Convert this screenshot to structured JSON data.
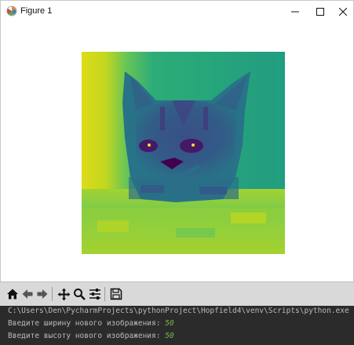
{
  "window": {
    "title": "Figure 1",
    "icon": "matplotlib-logo-icon",
    "controls": [
      "minimize-icon",
      "maximize-icon",
      "close-icon"
    ]
  },
  "figure": {
    "image_description_colormap": "viridis",
    "subject": "cat photo rendered as pixelated grayscale-to-viridis image"
  },
  "toolbar": {
    "tools": [
      "home-icon",
      "back-icon",
      "forward-icon",
      "pan-icon",
      "zoom-icon",
      "configure-subplots-icon",
      "save-icon"
    ]
  },
  "console": {
    "command": "C:\\Users\\Den\\PycharmProjects\\pythonProject\\Hopfield4\\venv\\Scripts\\python.exe C",
    "prompt_width": "Введите ширину нового изображения: ",
    "width_value": "50",
    "prompt_height": "Введите высоту нового изображения: ",
    "height_value": "50"
  },
  "colors": {
    "viridis_yellow": "#e2e418",
    "viridis_green": "#5ec962",
    "viridis_teal": "#21918c",
    "viridis_blue": "#3b528b",
    "viridis_purple": "#440154",
    "console_bg": "#2b2b2b",
    "console_input": "#72b94f"
  }
}
